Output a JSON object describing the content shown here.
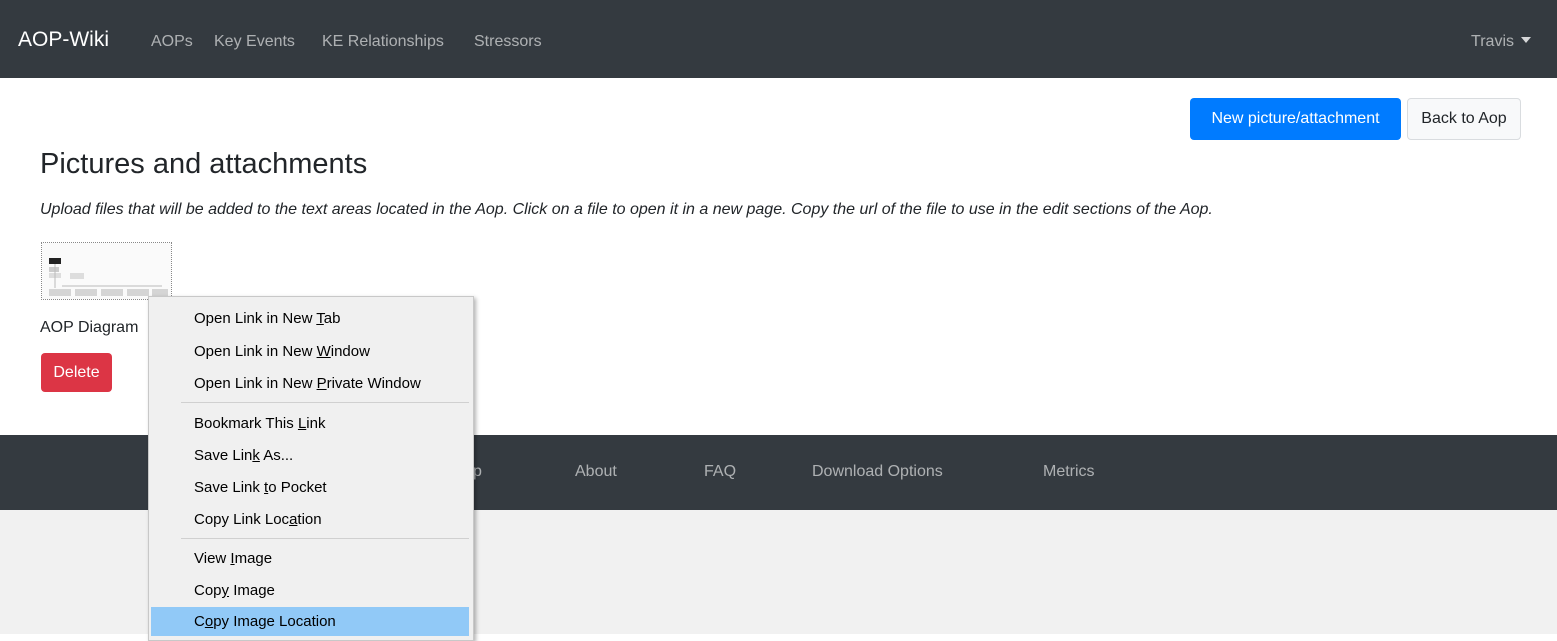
{
  "navbar": {
    "brand": "AOP-Wiki",
    "links": [
      "AOPs",
      "Key Events",
      "KE Relationships",
      "Stressors"
    ],
    "user": "Travis"
  },
  "actions": {
    "new_label": "New picture/attachment",
    "back_label": "Back to Aop"
  },
  "page": {
    "title": "Pictures and attachments",
    "description": "Upload files that will be added to the text areas located in the Aop. Click on a file to open it in a new page. Copy the url of the file to use in the edit sections of the Aop."
  },
  "attachment": {
    "caption": "AOP Diagram",
    "delete_label": "Delete"
  },
  "footer": {
    "links": [
      "Help",
      "About",
      "FAQ",
      "Download Options",
      "Metrics"
    ]
  },
  "context_menu": {
    "items": [
      {
        "pre": "Open Link in New ",
        "key": "T",
        "post": "ab"
      },
      {
        "pre": "Open Link in New ",
        "key": "W",
        "post": "indow"
      },
      {
        "pre": "Open Link in New ",
        "key": "P",
        "post": "rivate Window"
      },
      {
        "pre": "Bookmark This ",
        "key": "L",
        "post": "ink"
      },
      {
        "pre": "Save Lin",
        "key": "k",
        "post": " As..."
      },
      {
        "pre": "Save Link ",
        "key": "t",
        "post": "o Pocket"
      },
      {
        "pre": "Copy Link Loc",
        "key": "a",
        "post": "tion"
      },
      {
        "pre": "View ",
        "key": "I",
        "post": "mage"
      },
      {
        "pre": "Cop",
        "key": "y",
        "post": " Image"
      },
      {
        "pre": "C",
        "key": "o",
        "post": "py Image Location"
      }
    ],
    "highlighted_index": 9
  },
  "colors": {
    "navbar_bg": "#343a40",
    "primary": "#007bff",
    "danger": "#dc3545",
    "menu_highlight": "#91c9f7"
  }
}
